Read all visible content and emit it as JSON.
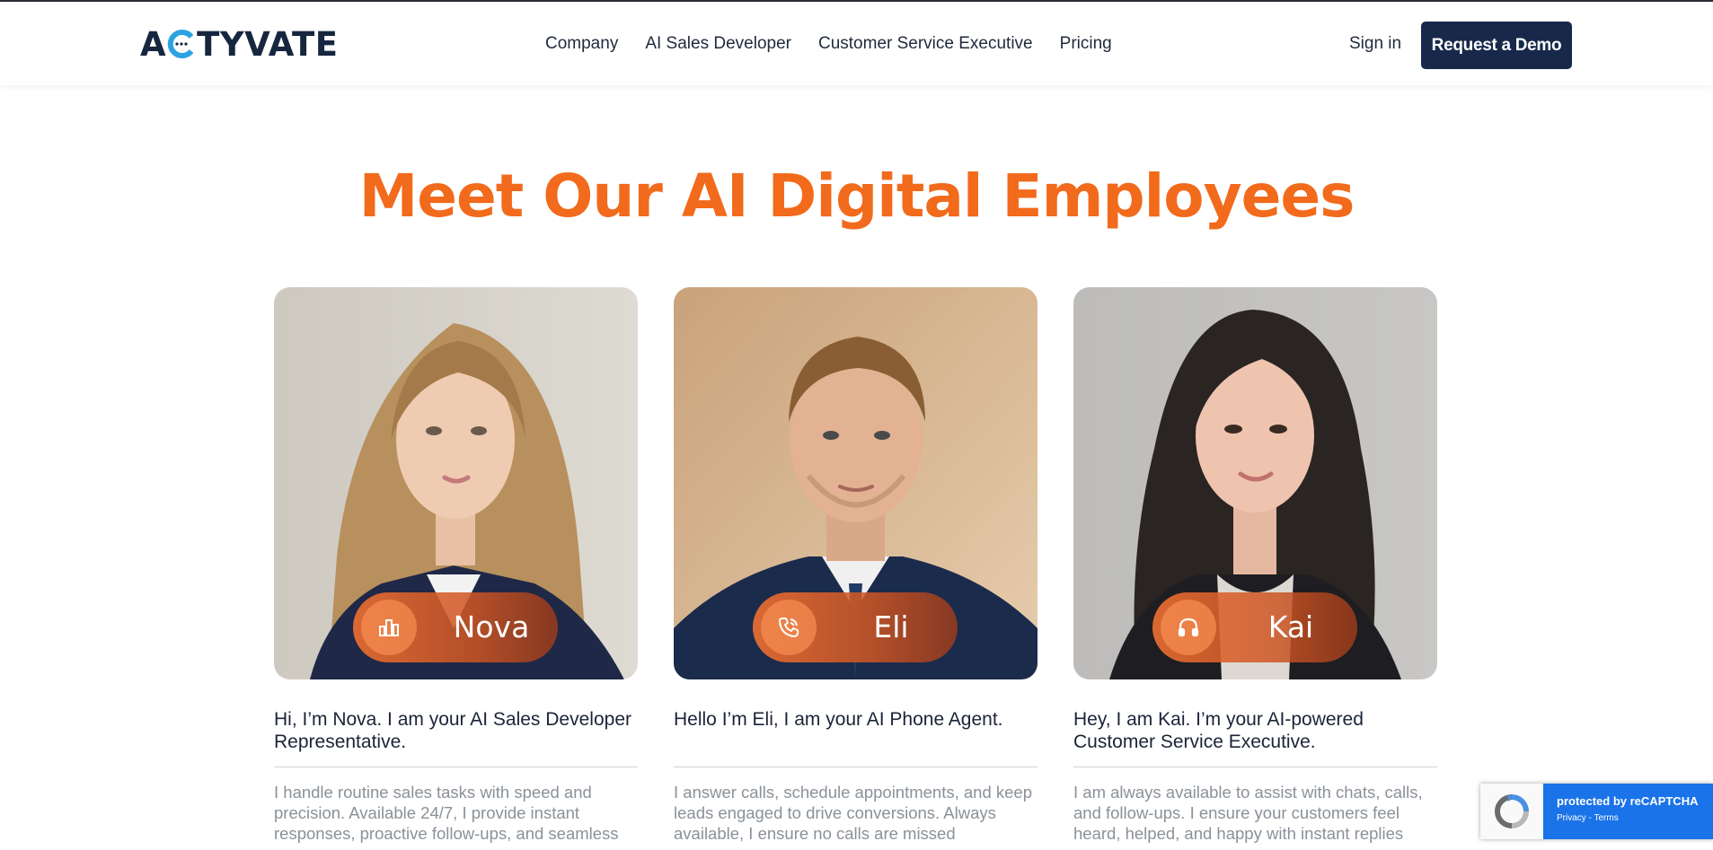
{
  "brand": {
    "logo_text_left": "A",
    "logo_text_right": "TYVATE",
    "accent_color": "#f26a1b",
    "navy": "#17284a"
  },
  "nav": {
    "links": [
      "Company",
      "AI Sales Developer",
      "Customer Service Executive",
      "Pricing"
    ],
    "sign_in": "Sign in",
    "demo_button": "Request a Demo"
  },
  "hero": {
    "title": "Meet Our AI Digital Employees"
  },
  "employees": [
    {
      "name": "Nova",
      "icon": "bar-chart-icon",
      "intro": "Hi, I’m Nova. I am your AI Sales Developer Representative.",
      "description": "I handle routine sales tasks with speed and precision. Available 24/7, I provide instant responses, proactive follow-ups, and seamless"
    },
    {
      "name": "Eli",
      "icon": "phone-icon",
      "intro": "Hello I’m Eli, I am your AI Phone Agent.",
      "description": "I answer calls, schedule appointments, and keep leads engaged to drive conversions. Always available, I ensure no calls are missed"
    },
    {
      "name": "Kai",
      "icon": "headphones-icon",
      "intro": "Hey, I am Kai. I’m your AI-powered Customer Service Executive.",
      "description": "I am always available to assist with chats, calls, and follow-ups. I ensure your customers feel heard, helped, and happy with instant replies"
    }
  ],
  "recaptcha": {
    "line1": "protected by reCAPTCHA",
    "line2": "Privacy - Terms"
  }
}
